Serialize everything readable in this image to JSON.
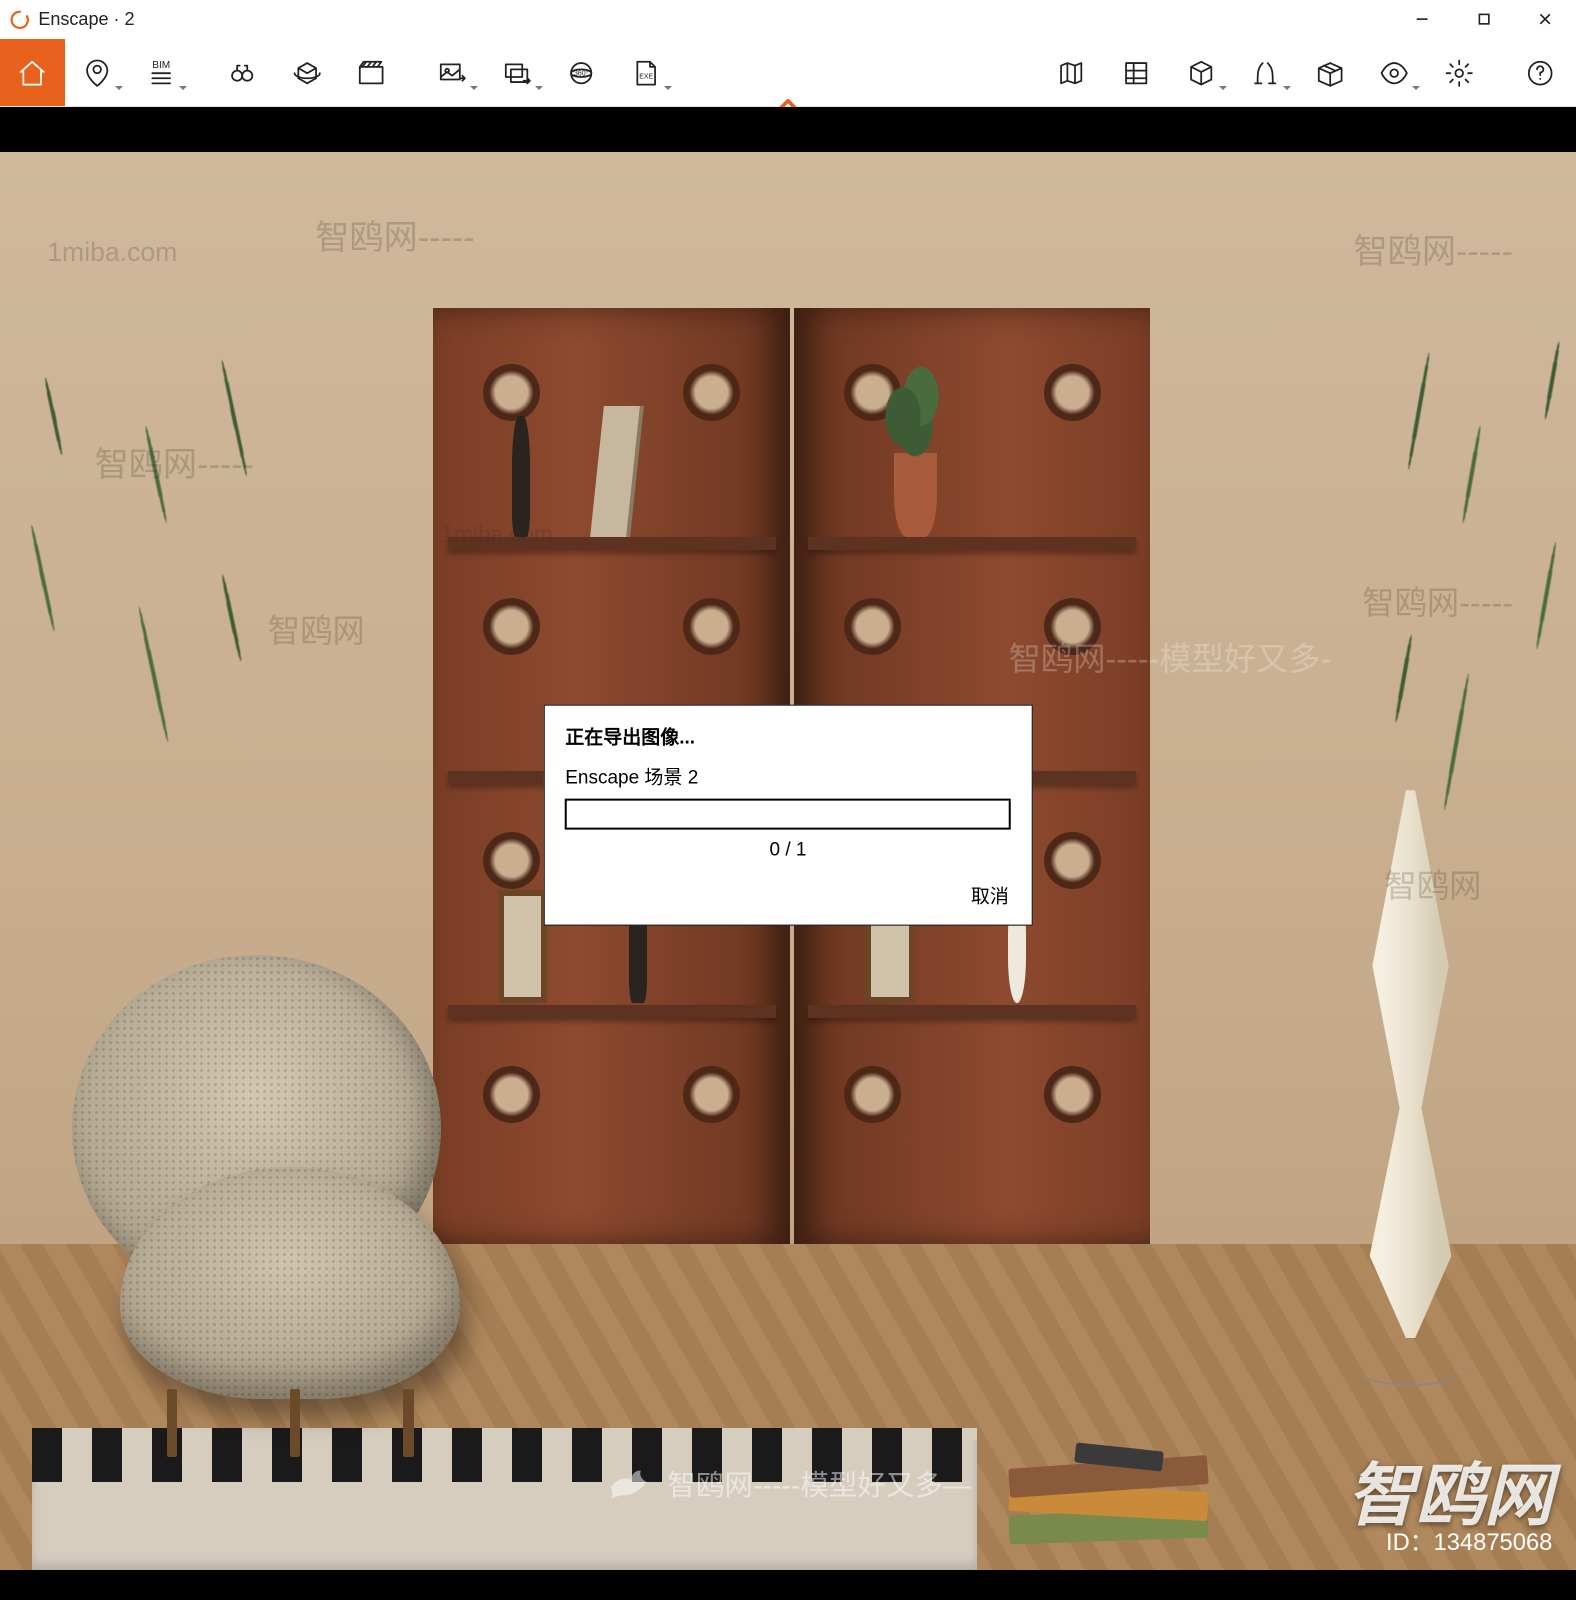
{
  "window": {
    "title": "Enscape · 2",
    "logo_letter": "e",
    "controls": {
      "min": "minimize",
      "max": "maximize",
      "close": "close"
    }
  },
  "toolbar": {
    "left_groups": [
      [
        "home-icon",
        "location-pin-icon",
        "bim-layers-icon"
      ],
      [
        "binoculars-icon",
        "orbit-cube-icon",
        "clapperboard-icon"
      ],
      [
        "export-image-icon",
        "export-batch-icon",
        "export-360-icon",
        "export-exe-icon"
      ]
    ],
    "right": [
      "map-icon",
      "library-icon",
      "cube-icon",
      "curtain-icon",
      "box-open-icon",
      "eye-icon",
      "gear-icon",
      "help-icon"
    ],
    "bim_label": "BIM",
    "pano_label": "360°",
    "exe_label": "EXE"
  },
  "dialog": {
    "title": "正在导出图像...",
    "subtitle": "Enscape 场景 2",
    "counter": "0 / 1",
    "cancel": "取消",
    "progress_pct": 0
  },
  "watermarks": {
    "site_en": "1miba.com",
    "site_cn": "智鸥网",
    "slogan_cn_a": "智鸥网-----",
    "slogan_cn_b": "智鸥网-----模型好又多-",
    "bird_center": "智鸥网-----模型好又多—",
    "big": "智鸥网",
    "id_label": "ID：134875068"
  },
  "colors": {
    "accent": "#e9621d",
    "wood": "#7a3d25",
    "wall": "#c9b096"
  }
}
